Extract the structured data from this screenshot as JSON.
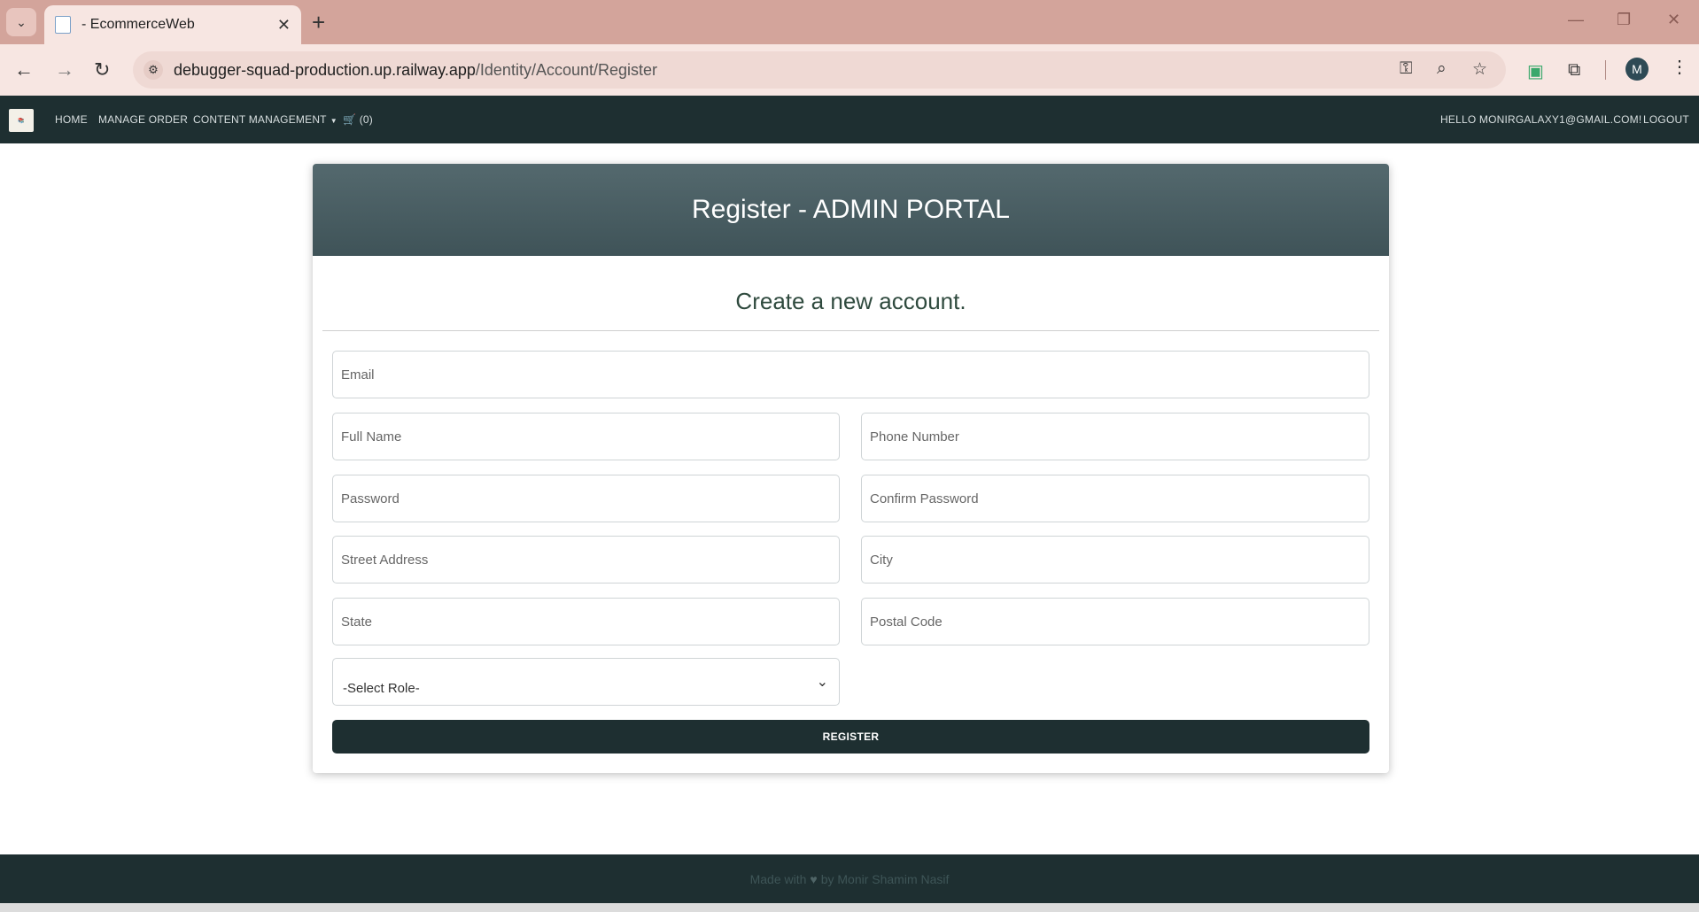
{
  "browser": {
    "tab_title": "- EcommerceWeb",
    "new_tab": "+",
    "url_host": "debugger-squad-production.up.railway.app",
    "url_path": "/Identity/Account/Register",
    "profile_initial": "M",
    "icons": [
      "tab-list-icon",
      "favicon-icon",
      "close-icon",
      "back-icon",
      "forward-icon",
      "reload-icon",
      "site-info-icon",
      "password-key-icon",
      "zoom-icon",
      "bookmark-star-icon",
      "extension-icon",
      "puzzle-icon",
      "menu-kebab-icon",
      "minimize-icon",
      "restore-icon",
      "window-close-icon"
    ]
  },
  "nav": {
    "home": "HOME",
    "manage_order": "MANAGE ORDER",
    "content_management": "CONTENT MANAGEMENT",
    "cart_count": "(0)",
    "hello": "HELLO MONIRGALAXY1@GMAIL.COM!",
    "logout": "LOGOUT"
  },
  "card": {
    "title": "Register - ADMIN PORTAL",
    "subtitle": "Create a new account."
  },
  "form": {
    "email": "Email",
    "full_name": "Full Name",
    "phone": "Phone Number",
    "password": "Password",
    "confirm_password": "Confirm Password",
    "street": "Street Address",
    "city": "City",
    "state": "State",
    "postal": "Postal Code",
    "role_selected": "-Select Role-",
    "register": "REGISTER"
  },
  "footer": {
    "made_with": "Made with",
    "by": "by Monir Shamim Nasif"
  },
  "colors": {
    "browser_frame": "#d3a49b",
    "nav_bg": "#1e2f31",
    "header_gradient": "#4a5f64",
    "button_bg": "#1e2f31"
  }
}
